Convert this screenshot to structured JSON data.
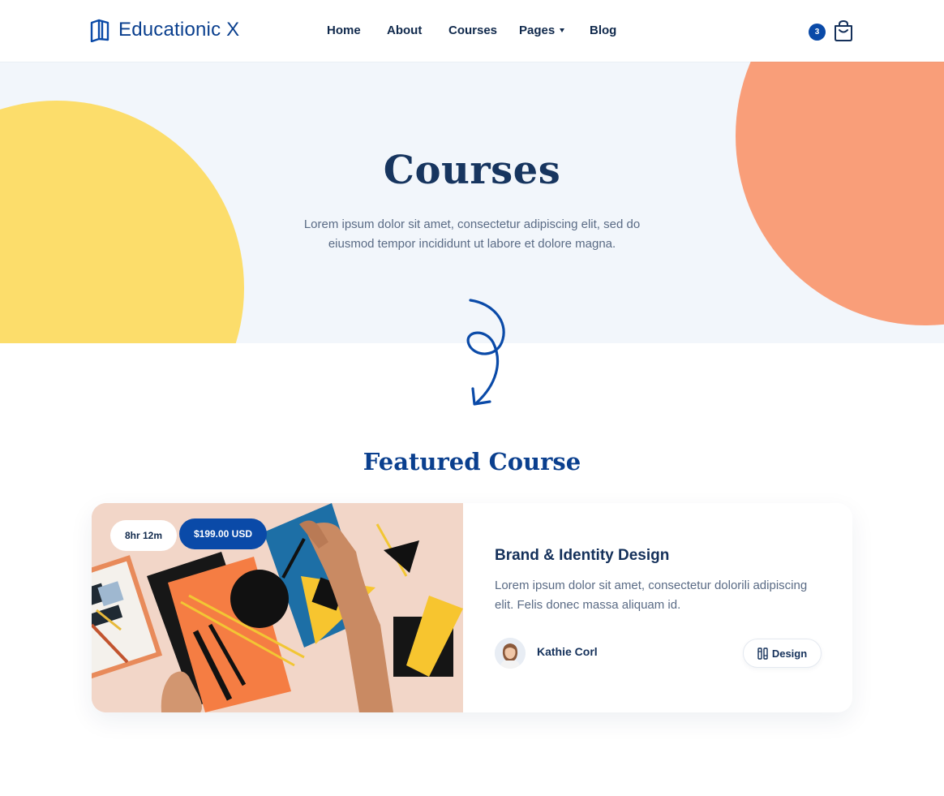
{
  "header": {
    "logo_text": "Educationic X",
    "nav": [
      {
        "label": "Home"
      },
      {
        "label": "About"
      },
      {
        "label": "Courses"
      },
      {
        "label": "Pages"
      },
      {
        "label": "Blog"
      }
    ],
    "cart_count": "3"
  },
  "hero": {
    "title": "Courses",
    "description": "Lorem ipsum dolor sit amet, consectetur adipiscing elit, sed do eiusmod tempor incididunt ut labore et dolore magna."
  },
  "featured": {
    "heading": "Featured Course",
    "course": {
      "duration": "8hr 12m",
      "price": "$199.00 USD",
      "title": "Brand & Identity Design",
      "description": "Lorem ipsum dolor sit amet, consectetur dolorili adipiscing elit. Felis donec massa aliquam id.",
      "author": "Kathie Corl",
      "category": "Design"
    }
  },
  "colors": {
    "brand_blue": "#0a4aa8",
    "navy_text": "#14305a",
    "hero_bg": "#f2f6fb",
    "yellow": "#fcdd6b",
    "orange": "#f99e79"
  },
  "icons": {
    "logo": "open-book-icon",
    "cart": "shopping-bag-icon",
    "category": "design-tools-icon"
  }
}
